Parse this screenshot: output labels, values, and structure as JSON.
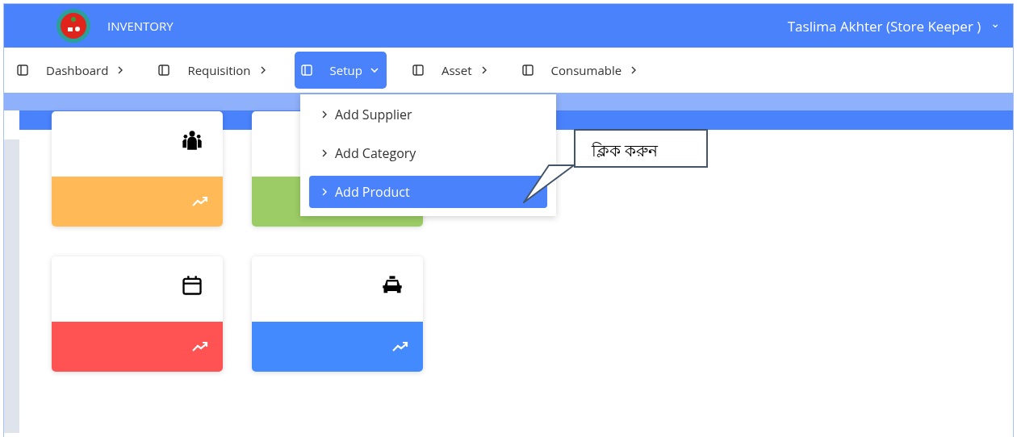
{
  "header": {
    "app_title": "INVENTORY",
    "user": "Taslima Akhter (Store Keeper )",
    "user_caret": "⌄"
  },
  "nav": [
    {
      "label": "Dashboard",
      "selected": false,
      "expanded": false
    },
    {
      "label": "Requisition",
      "selected": false,
      "expanded": false
    },
    {
      "label": "Setup",
      "selected": true,
      "expanded": true
    },
    {
      "label": "Asset",
      "selected": false,
      "expanded": false
    },
    {
      "label": "Consumable",
      "selected": false,
      "expanded": false
    }
  ],
  "setup_menu": [
    {
      "label": "Add Supplier",
      "selected": false
    },
    {
      "label": "Add Category",
      "selected": false
    },
    {
      "label": "Add Product",
      "selected": true
    }
  ],
  "cards": [
    {
      "kind": "people",
      "color": "#ffb957"
    },
    {
      "kind": "covered",
      "color": "#9ccc65"
    },
    {
      "kind": "calendar",
      "color": "#ff5252"
    },
    {
      "kind": "taxi",
      "color": "#448aff"
    }
  ],
  "callout": {
    "text": "ক্লিক করুন"
  }
}
